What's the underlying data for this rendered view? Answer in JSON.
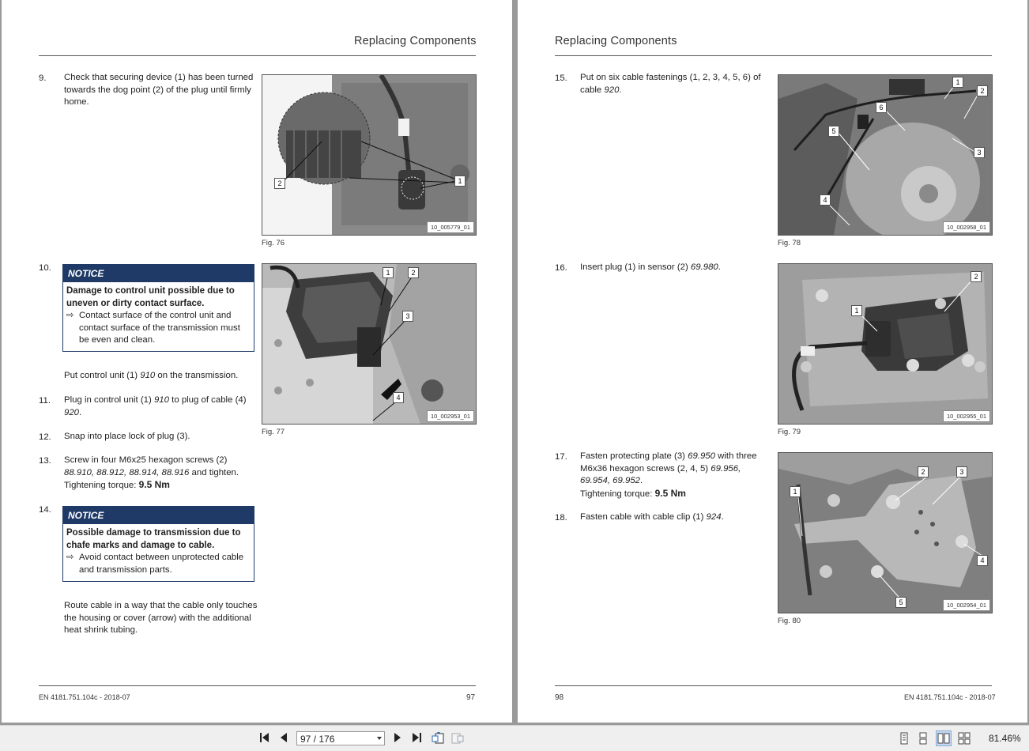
{
  "header": {
    "left": "Replacing Components",
    "right": "Replacing Components"
  },
  "left_page": {
    "steps": [
      {
        "num": "9.",
        "text": "Check that securing device (1) has been turned towards the dog point (2) of the plug until firmly home."
      },
      {
        "num": "10."
      },
      {
        "num": "11."
      },
      {
        "num": "12.",
        "text": "Snap into place lock of plug (3)."
      },
      {
        "num": "13."
      },
      {
        "num": "14."
      }
    ],
    "notice1": {
      "label": "NOTICE",
      "title": "Damage to control unit possible due to uneven or dirty contact surface.",
      "arrow": "⇨",
      "body": "Contact surface of the control unit and contact surface of the transmission must be even and clean."
    },
    "step10_after": {
      "pre": "Put control unit (1) ",
      "ref": "910",
      "post": " on the transmission."
    },
    "step11": {
      "pre": "Plug in control unit (1) ",
      "ref1": "910",
      "mid": " to plug of cable (4) ",
      "ref2": "920",
      "post": "."
    },
    "step13": {
      "pre": "Screw in four M6x25 hexagon screws (2) ",
      "refs": "88.910, 88.912, 88.914, 88.916",
      "post": " and tighten.",
      "torque_label": "Tightening torque: ",
      "torque": "9.5 Nm"
    },
    "notice2": {
      "label": "NOTICE",
      "title": "Possible damage to transmission due to chafe marks and damage to cable.",
      "arrow": "⇨",
      "body": "Avoid contact between unprotected cable and transmission parts."
    },
    "step14_after": "Route cable in a way that the cable only touches the housing or cover (arrow) with the additional heat shrink tubing.",
    "fig76": {
      "caption": "Fig. 76",
      "code": "10_005779_01",
      "callouts": [
        "2",
        "1"
      ]
    },
    "fig77": {
      "caption": "Fig. 77",
      "code": "10_002953_01",
      "callouts": [
        "1",
        "2",
        "3",
        "4"
      ]
    },
    "footer": {
      "doc": "EN 4181.751.104c - 2018-07",
      "page": "97"
    }
  },
  "right_page": {
    "step15": {
      "num": "15.",
      "pre": "Put on six cable fastenings (1, 2, 3, 4, 5, 6) of cable ",
      "ref": "920",
      "post": "."
    },
    "step16": {
      "num": "16.",
      "pre": "Insert plug (1) in sensor (2) ",
      "ref": "69.980",
      "post": "."
    },
    "step17": {
      "num": "17.",
      "pre": "Fasten protecting plate (3) ",
      "ref1": "69.950",
      "mid": " with three M6x36 hexagon screws (2, 4, 5) ",
      "ref2": "69.956, 69.954, 69.952",
      "post": ".",
      "torque_label": "Tightening torque: ",
      "torque": "9.5 Nm"
    },
    "step18": {
      "num": "18.",
      "pre": "Fasten cable with cable clip (1) ",
      "ref": "924",
      "post": "."
    },
    "fig78": {
      "caption": "Fig. 78",
      "code": "10_002958_01",
      "callouts": [
        "1",
        "2",
        "6",
        "5",
        "3",
        "4"
      ]
    },
    "fig79": {
      "caption": "Fig. 79",
      "code": "10_002955_01",
      "callouts": [
        "2",
        "1"
      ]
    },
    "fig80": {
      "caption": "Fig. 80",
      "code": "10_002954_01",
      "callouts": [
        "2",
        "3",
        "1",
        "4",
        "5"
      ]
    },
    "footer": {
      "doc": "EN 4181.751.104c - 2018-07",
      "page": "98"
    }
  },
  "toolbar": {
    "page_indicator": "97 / 176",
    "zoom": "81.46%"
  },
  "icons": {
    "first": "first-page-icon",
    "prev": "prev-page-icon",
    "next": "next-page-icon",
    "last": "last-page-icon"
  }
}
